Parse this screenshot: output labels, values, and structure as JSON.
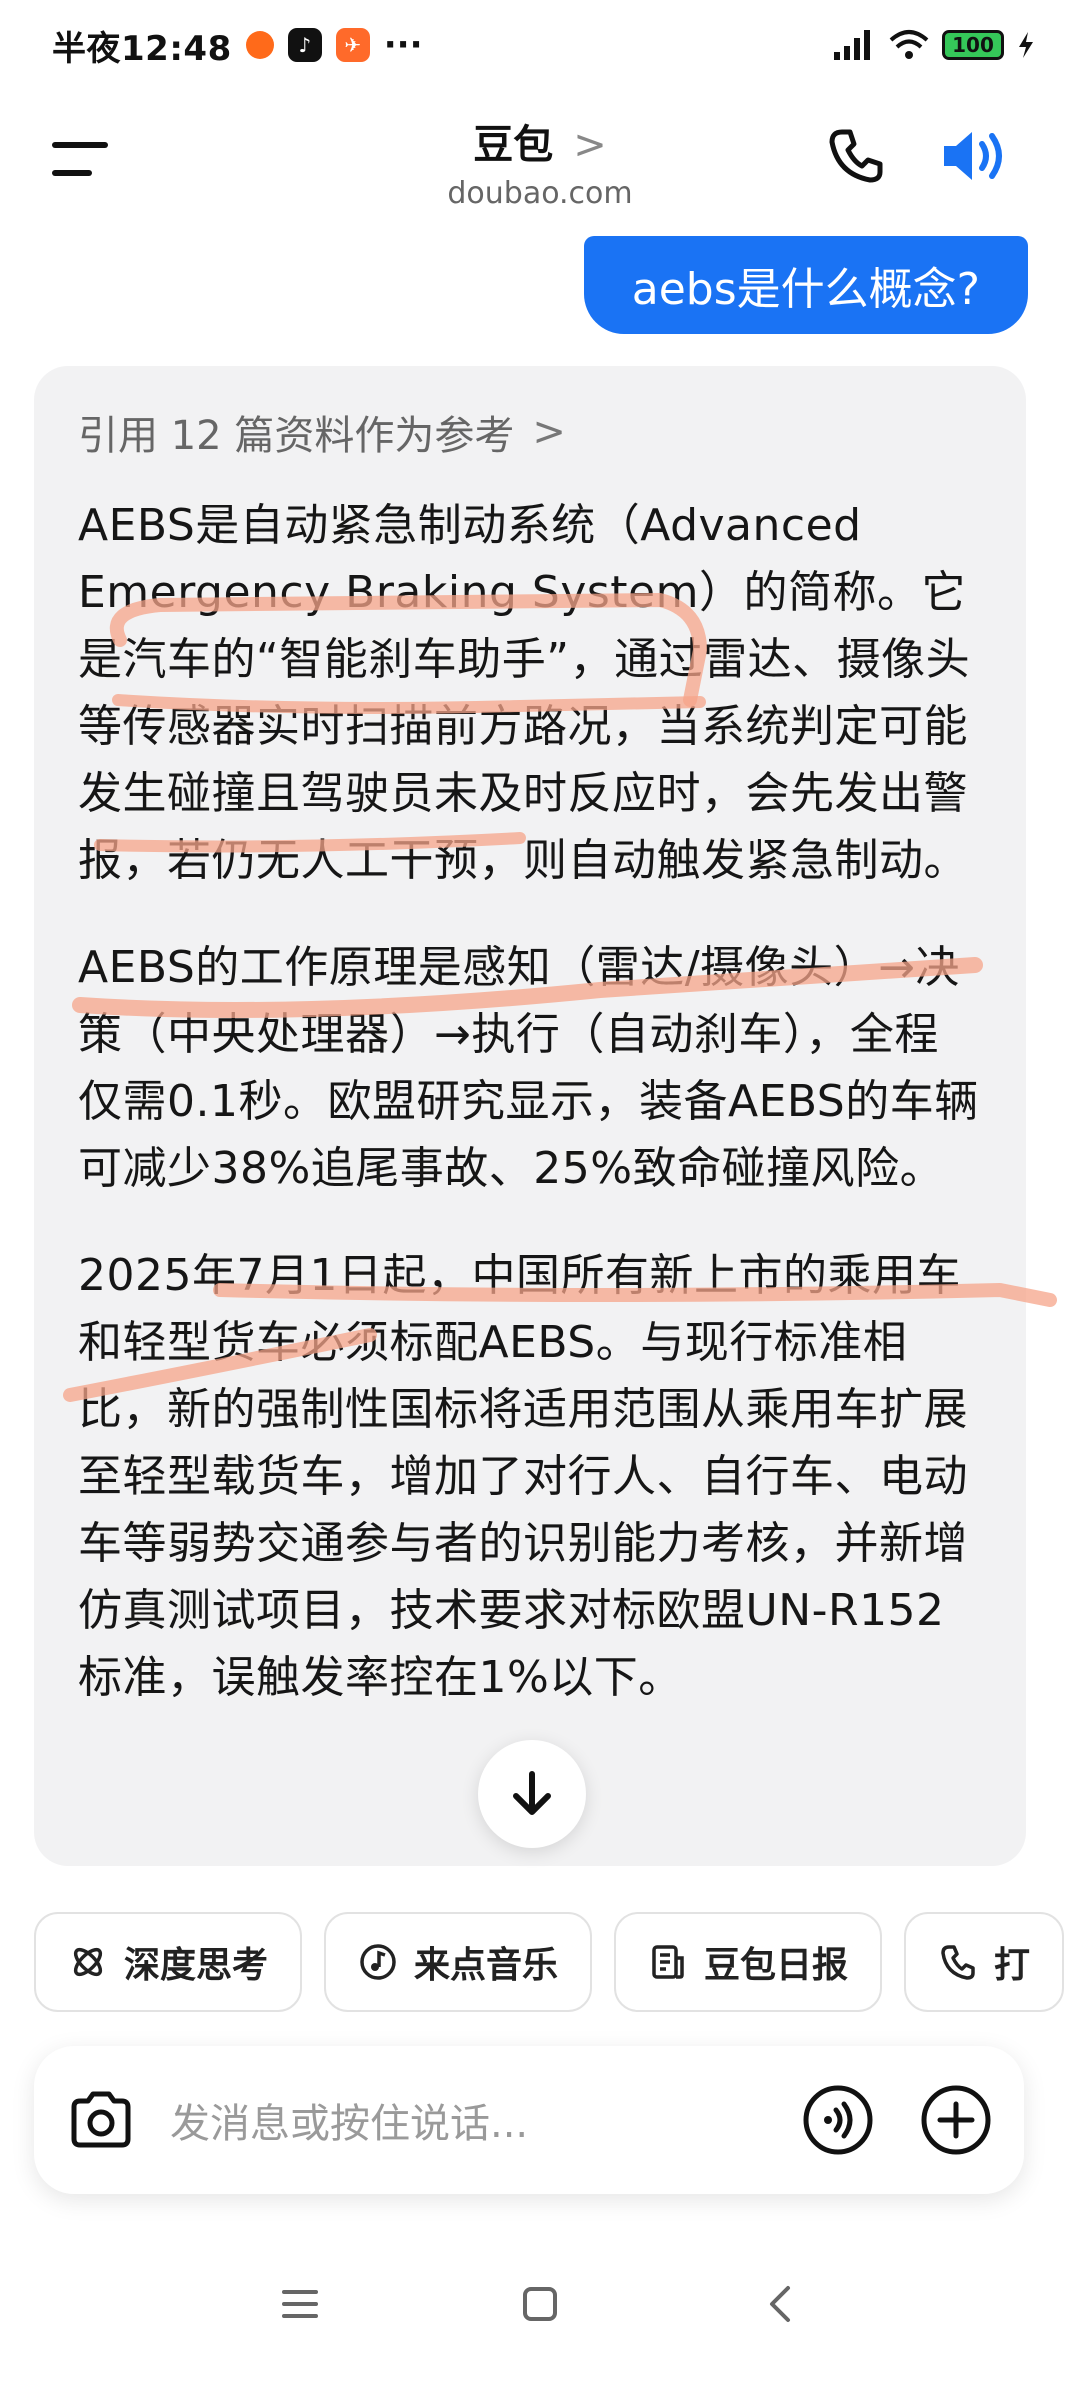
{
  "status_bar": {
    "time": "半夜12:48",
    "more": "···",
    "battery": "100"
  },
  "header": {
    "title": "豆包",
    "title_chevron": ">",
    "subtitle": "doubao.com"
  },
  "user_message": "aebs是什么概念?",
  "answer": {
    "reference_link": "引用 12 篇资料作为参考",
    "reference_chevron": ">",
    "paragraphs": [
      "AEBS是自动紧急制动系统（Advanced Emergency Braking System）的简称。它是汽车的“智能刹车助手”，通过雷达、摄像头等传感器实时扫描前方路况，当系统判定可能发生碰撞且驾驶员未及时反应时，会先发出警报，若仍无人工干预，则自动触发紧急制动。",
      "AEBS的工作原理是感知（雷达/摄像头）→决策（中央处理器）→执行（自动刹车），全程仅需0.1秒。欧盟研究显示，装备AEBS的车辆可减少38%追尾事故、25%致命碰撞风险。",
      "2025年7月1日起，中国所有新上市的乘用车和轻型货车必须标配AEBS。与现行标准相比，新的强制性国标将适用范围从乘用车扩展至轻型载货车，增加了对行人、自行车、电动车等弱势交通参与者的识别能力考核，并新增仿真测试项目，技术要求对标欧盟UN-R152标准，误触发率控在1%以下。"
    ]
  },
  "chips": [
    {
      "label": "深度思考",
      "icon": "deep-think-icon"
    },
    {
      "label": "来点音乐",
      "icon": "music-icon"
    },
    {
      "label": "豆包日报",
      "icon": "daily-report-icon"
    },
    {
      "label": "打",
      "icon": "phone-icon"
    }
  ],
  "input": {
    "placeholder": "发消息或按住说话..."
  },
  "colors": {
    "accent": "#1a73f4",
    "highlight": "#f5a48a"
  }
}
